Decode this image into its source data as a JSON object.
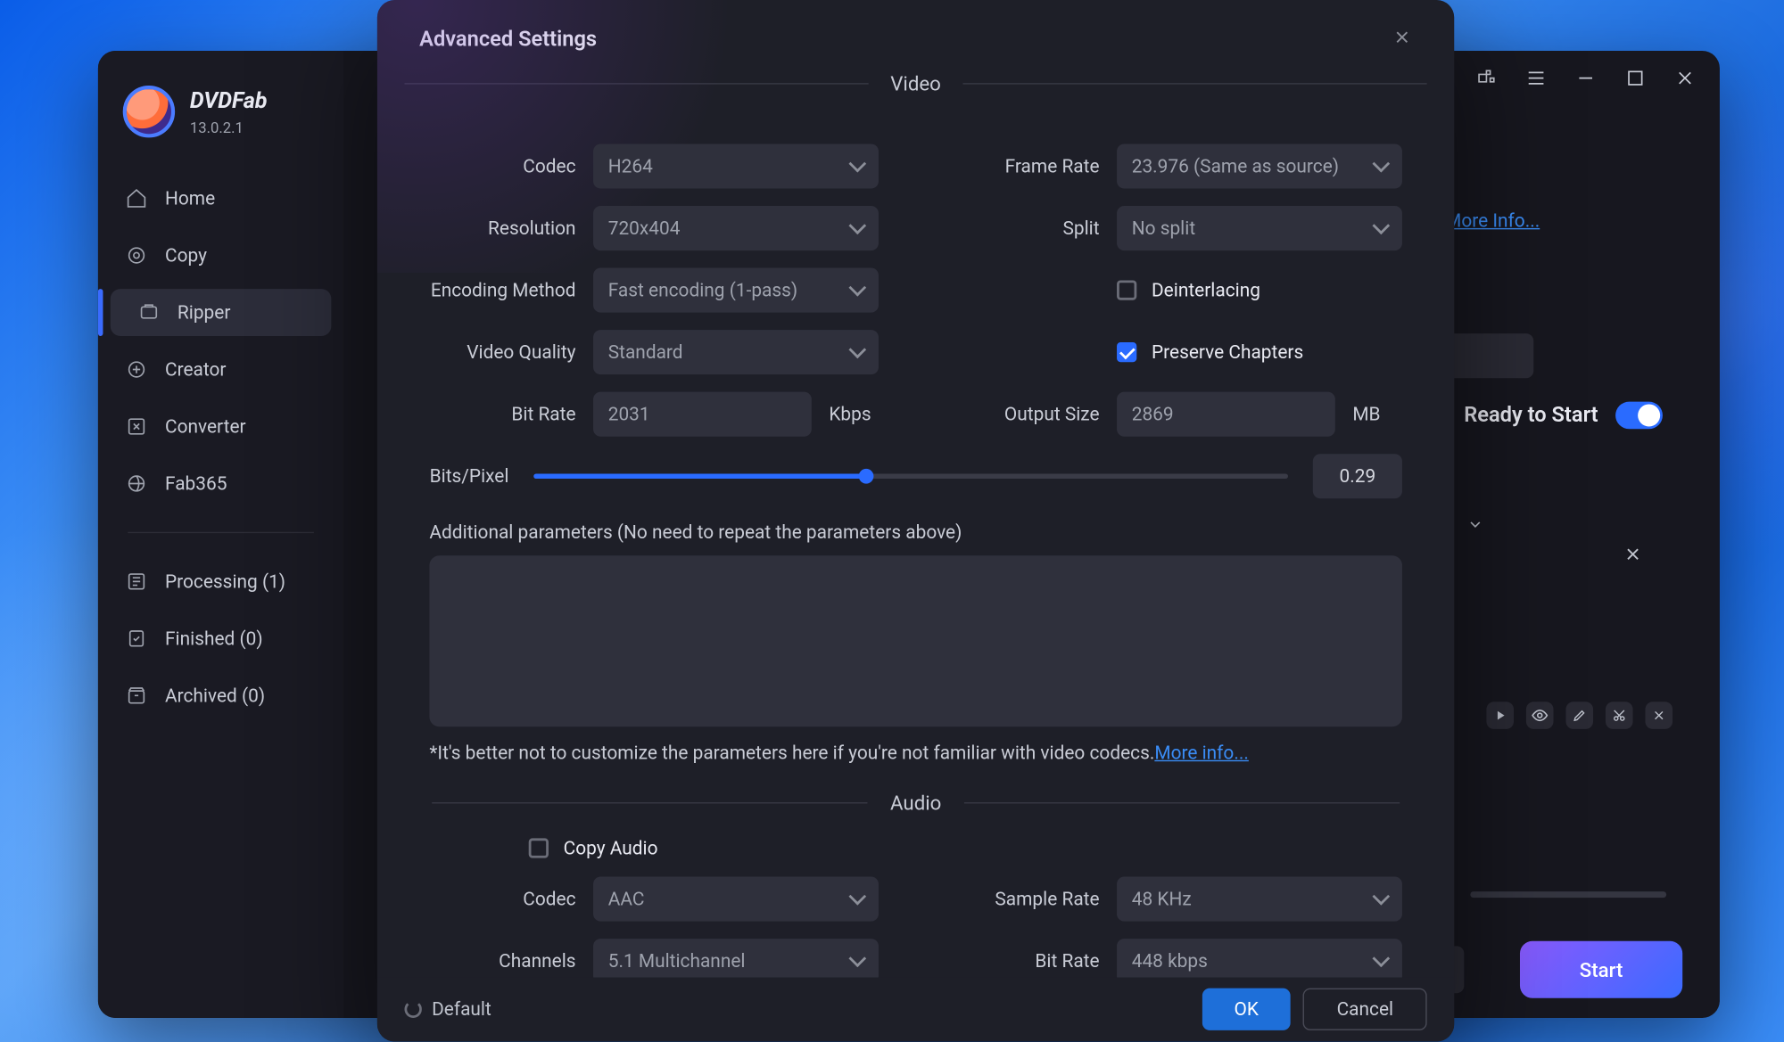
{
  "brand": {
    "name": "DVDFab",
    "version": "13.0.2.1"
  },
  "sidebar": {
    "items": [
      {
        "label": "Home"
      },
      {
        "label": "Copy"
      },
      {
        "label": "Ripper"
      },
      {
        "label": "Creator"
      },
      {
        "label": "Converter"
      },
      {
        "label": "Fab365"
      }
    ],
    "status": {
      "processing": "Processing (1)",
      "finished": "Finished (0)",
      "archived": "Archived (0)"
    }
  },
  "host": {
    "more_info": "More Info...",
    "ready_label": "Ready to Start",
    "start": "Start"
  },
  "modal": {
    "title": "Advanced Settings",
    "section_video": "Video",
    "section_audio": "Audio",
    "video": {
      "codec_label": "Codec",
      "codec_value": "H264",
      "framerate_label": "Frame Rate",
      "framerate_value": "23.976 (Same as source)",
      "resolution_label": "Resolution",
      "resolution_value": "720x404",
      "split_label": "Split",
      "split_value": "No split",
      "encoding_label": "Encoding Method",
      "encoding_value": "Fast encoding (1-pass)",
      "deinterlace_label": "Deinterlacing",
      "quality_label": "Video Quality",
      "quality_value": "Standard",
      "preserve_label": "Preserve Chapters",
      "bitrate_label": "Bit Rate",
      "bitrate_value": "2031",
      "bitrate_unit": "Kbps",
      "output_label": "Output Size",
      "output_value": "2869",
      "output_unit": "MB",
      "bitspixel_label": "Bits/Pixel",
      "bitspixel_value": "0.29",
      "params_label": "Additional parameters (No need to repeat the parameters above)",
      "note_text": "*It's better not to customize the parameters here if you're not familiar with video codecs.",
      "note_link": "More info..."
    },
    "audio": {
      "copy_label": "Copy Audio",
      "codec_label": "Codec",
      "codec_value": "AAC",
      "samplerate_label": "Sample Rate",
      "samplerate_value": "48 KHz",
      "channels_label": "Channels",
      "channels_value": "5.1 Multichannel",
      "bitrate_label": "Bit Rate",
      "bitrate_value": "448 kbps"
    },
    "footer": {
      "default": "Default",
      "ok": "OK",
      "cancel": "Cancel"
    }
  }
}
